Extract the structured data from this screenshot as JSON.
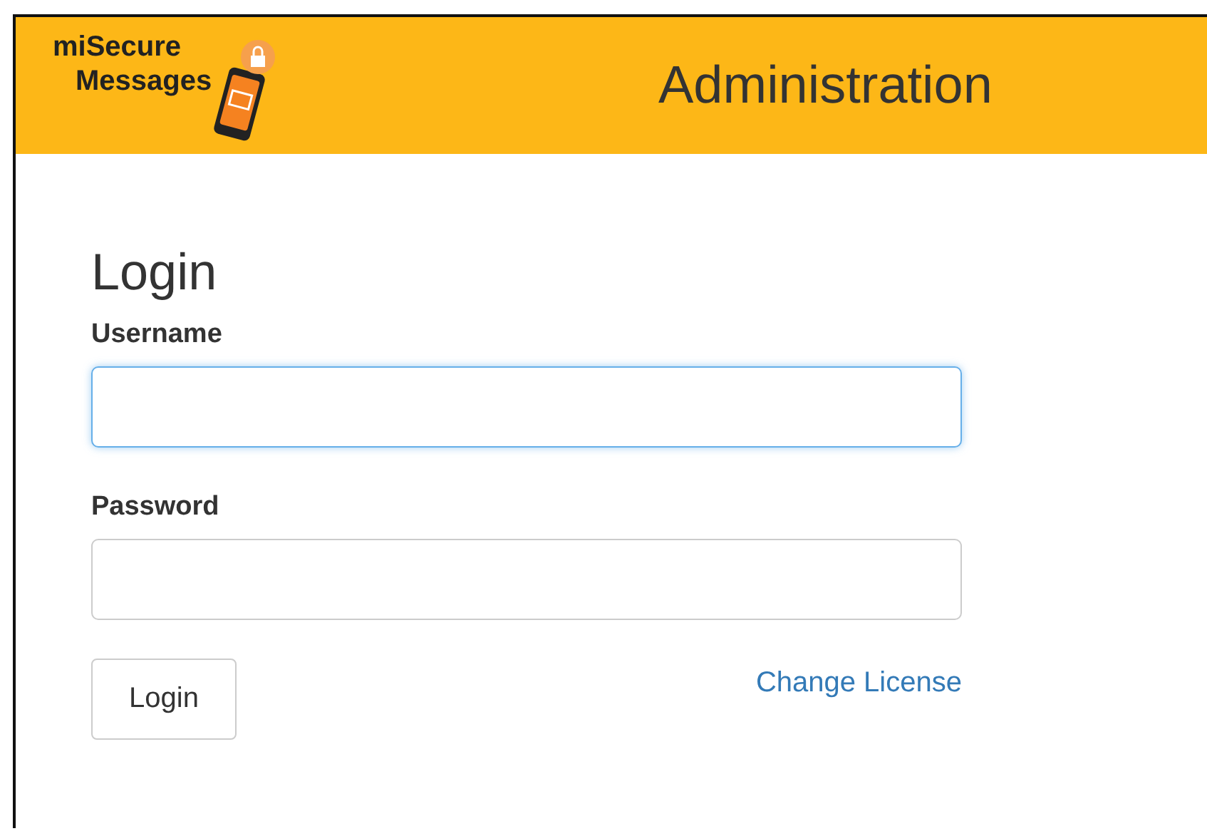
{
  "header": {
    "logo_lines": [
      "miSecure",
      "Messages"
    ],
    "title": "Administration"
  },
  "form": {
    "heading": "Login",
    "fields": [
      {
        "label": "Username",
        "focused": true
      },
      {
        "label": "Password",
        "focused": false
      }
    ],
    "button": "Login",
    "link": "Change License"
  }
}
